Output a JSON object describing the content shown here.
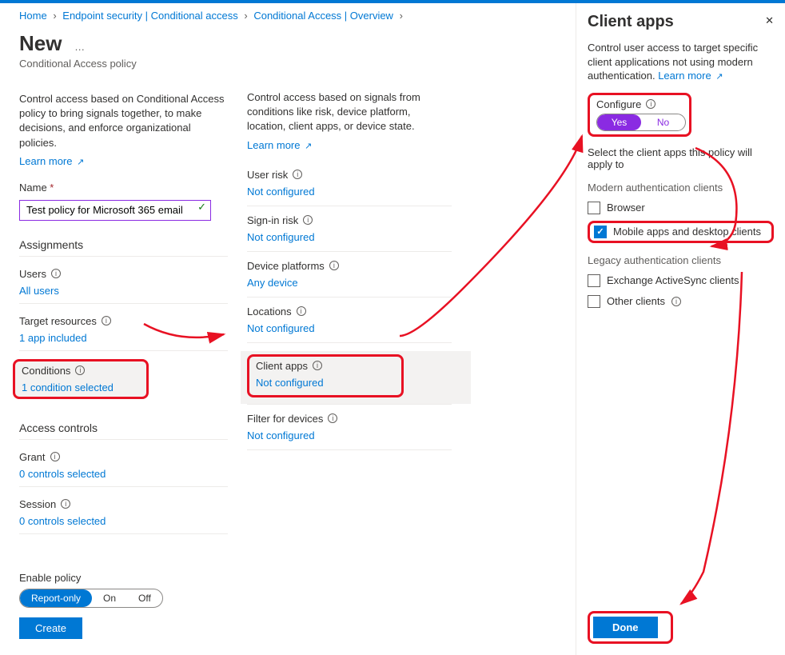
{
  "breadcrumb": {
    "home": "Home",
    "ep": "Endpoint security | Conditional access",
    "ca": "Conditional Access | Overview"
  },
  "page": {
    "title": "New",
    "subtitle": "Conditional Access policy",
    "desc_left": "Control access based on Conditional Access policy to bring signals together, to make decisions, and enforce organizational policies.",
    "learn_more": "Learn more",
    "name_label": "Name",
    "name_value": "Test policy for Microsoft 365 email",
    "assignments": "Assignments",
    "users_label": "Users",
    "users_value": "All users",
    "target_label": "Target resources",
    "target_value": "1 app included",
    "cond_label": "Conditions",
    "cond_value": "1 condition selected",
    "access_controls": "Access controls",
    "grant_label": "Grant",
    "grant_value": "0 controls selected",
    "session_label": "Session",
    "session_value": "0 controls selected"
  },
  "conditions": {
    "desc": "Control access based on signals from conditions like risk, device platform, location, client apps, or device state.",
    "user_risk": "User risk",
    "user_risk_val": "Not configured",
    "signin_risk": "Sign-in risk",
    "signin_risk_val": "Not configured",
    "device_platforms": "Device platforms",
    "device_platforms_val": "Any device",
    "locations": "Locations",
    "locations_val": "Not configured",
    "client_apps": "Client apps",
    "client_apps_val": "Not configured",
    "filter_devices": "Filter for devices",
    "filter_devices_val": "Not configured"
  },
  "footer": {
    "enable_policy": "Enable policy",
    "report_only": "Report-only",
    "on": "On",
    "off": "Off",
    "create": "Create"
  },
  "panel": {
    "title": "Client apps",
    "desc": "Control user access to target specific client applications not using modern authentication.",
    "configure": "Configure",
    "yes": "Yes",
    "no": "No",
    "select_text": "Select the client apps this policy will apply to",
    "modern_title": "Modern authentication clients",
    "browser": "Browser",
    "mobile": "Mobile apps and desktop clients",
    "legacy_title": "Legacy authentication clients",
    "exchange": "Exchange ActiveSync clients",
    "other": "Other clients",
    "done": "Done"
  }
}
